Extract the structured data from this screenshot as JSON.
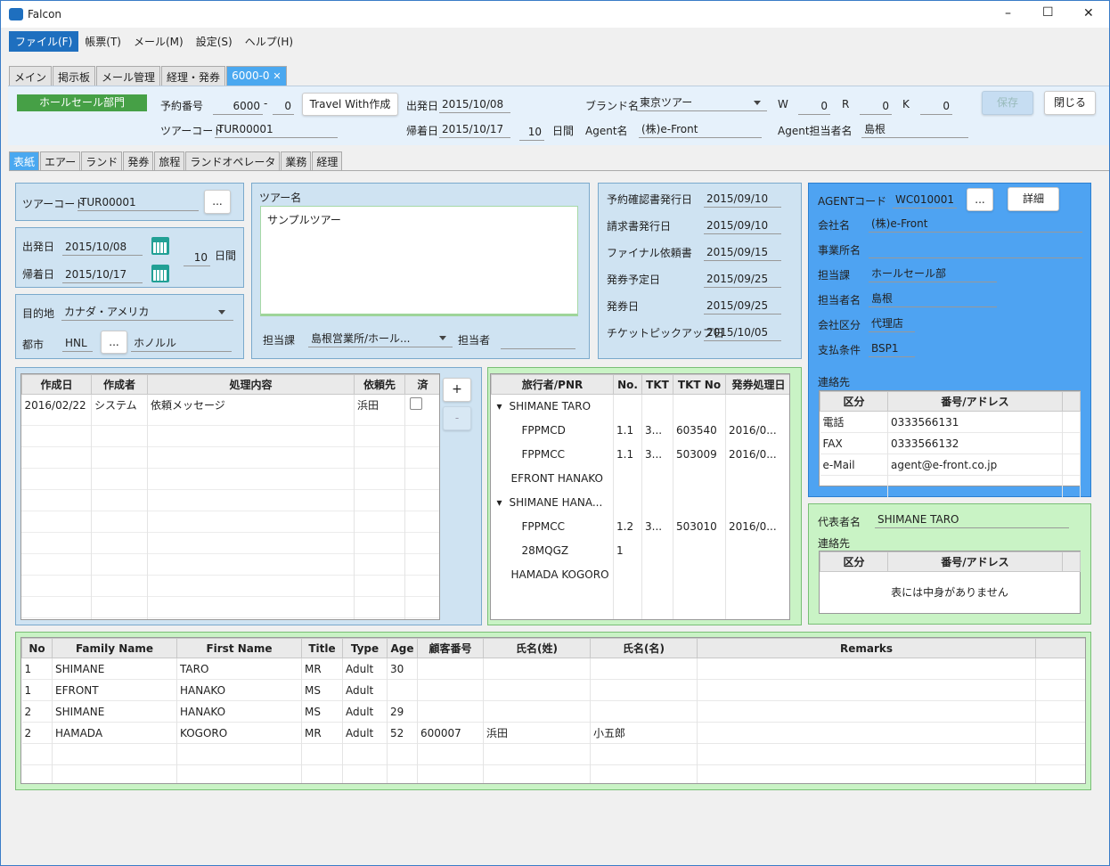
{
  "window": {
    "title": "Falcon",
    "min": "–",
    "max": "☐",
    "close": "✕"
  },
  "menubar": [
    "ファイル(F)",
    "帳票(T)",
    "メール(M)",
    "設定(S)",
    "ヘルプ(H)"
  ],
  "tabs": [
    "メイン",
    "掲示板",
    "メール管理",
    "経理・発券",
    "6000-0"
  ],
  "tab_close": "✕",
  "header": {
    "dept": "ホールセール部門",
    "booking_label": "予約番号",
    "booking_no": "6000",
    "booking_sep": "-",
    "booking_sub": "0",
    "travel_btn": "Travel With作成",
    "depart_label": "出発日",
    "depart": "2015/10/08",
    "brand_label": "ブランド名",
    "brand": "東京ツアー",
    "w_label": "W",
    "w": "0",
    "r_label": "R",
    "r": "0",
    "k_label": "K",
    "k": "0",
    "save": "保存",
    "close": "閉じる",
    "tour_label": "ツアーコード",
    "tour": "TUR00001",
    "return_label": "帰着日",
    "return": "2015/10/17",
    "days": "10",
    "days_label": "日間",
    "agent_label": "Agent名",
    "agent": "(株)e-Front",
    "agent_person_label": "Agent担当者名",
    "agent_person": "島根"
  },
  "subtabs": [
    "表紙",
    "エアー",
    "ランド",
    "発券",
    "旅程",
    "ランドオペレータ",
    "業務",
    "経理"
  ],
  "left": {
    "tour_label": "ツアーコード",
    "tour": "TUR00001",
    "dots": "...",
    "depart_label": "出発日",
    "depart": "2015/10/08",
    "return_label": "帰着日",
    "return": "2015/10/17",
    "days": "10",
    "days_label": "日間",
    "dest_label": "目的地",
    "dest": "カナダ・アメリカ",
    "city_label": "都市",
    "city_code": "HNL",
    "city_name": "ホノルル"
  },
  "tourname": {
    "label": "ツアー名",
    "value": "サンプルツアー",
    "dept_label": "担当課",
    "dept": "島根営業所/ホール...",
    "person_label": "担当者"
  },
  "dates": [
    {
      "label": "予約確認書発行日",
      "value": "2015/09/10"
    },
    {
      "label": "請求書発行日",
      "value": "2015/09/10"
    },
    {
      "label": "ファイナル依頼書",
      "value": "2015/09/15"
    },
    {
      "label": "発券予定日",
      "value": "2015/09/25"
    },
    {
      "label": "発券日",
      "value": "2015/09/25"
    },
    {
      "label": "チケットピックアップ日",
      "value": "2015/10/05"
    }
  ],
  "agent": {
    "code_label": "AGENTコード",
    "code": "WC010001",
    "dots": "...",
    "detail": "詳細",
    "company_label": "会社名",
    "company": "(株)e-Front",
    "office_label": "事業所名",
    "office": "",
    "section_label": "担当課",
    "section": "ホールセール部",
    "person_label": "担当者名",
    "person": "島根",
    "class_label": "会社区分",
    "class": "代理店",
    "pay_label": "支払条件",
    "pay": "BSP1",
    "contact_label": "連絡先",
    "contact_headers": [
      "区分",
      "番号/アドレス"
    ],
    "contacts": [
      [
        "電話",
        "0333566131"
      ],
      [
        "FAX",
        "0333566132"
      ],
      [
        "e-Mail",
        "agent@e-front.co.jp"
      ]
    ]
  },
  "rep": {
    "label": "代表者名",
    "name": "SHIMANE TARO",
    "contact_label": "連絡先",
    "headers": [
      "区分",
      "番号/アドレス"
    ],
    "empty": "表には中身がありません"
  },
  "history": {
    "headers": [
      "作成日",
      "作成者",
      "処理内容",
      "依頼先",
      "済"
    ],
    "rows": [
      [
        "2016/02/22",
        "システム",
        "依頼メッセージ",
        "浜田"
      ]
    ],
    "add": "+",
    "remove": "-"
  },
  "pnr": {
    "headers": [
      "旅行者/PNR",
      "No.",
      "TKT",
      "TKT No",
      "発券処理日"
    ],
    "rows": [
      {
        "name": "SHIMANE TARO",
        "lvl": 0,
        "exp": true,
        "no": "",
        "tkt": "",
        "tktno": "",
        "date": ""
      },
      {
        "name": "FPPMCD",
        "lvl": 1,
        "exp": false,
        "no": "1.1",
        "tkt": "3...",
        "tktno": "603540",
        "date": "2016/0..."
      },
      {
        "name": "FPPMCC",
        "lvl": 1,
        "exp": false,
        "no": "1.1",
        "tkt": "3...",
        "tktno": "503009",
        "date": "2016/0..."
      },
      {
        "name": "EFRONT HANAKO",
        "lvl": 0,
        "exp": false,
        "no": "",
        "tkt": "",
        "tktno": "",
        "date": ""
      },
      {
        "name": "SHIMANE HANA...",
        "lvl": 0,
        "exp": true,
        "no": "",
        "tkt": "",
        "tktno": "",
        "date": ""
      },
      {
        "name": "FPPMCC",
        "lvl": 1,
        "exp": false,
        "no": "1.2",
        "tkt": "3...",
        "tktno": "503010",
        "date": "2016/0..."
      },
      {
        "name": "28MQGZ",
        "lvl": 1,
        "exp": false,
        "no": "1",
        "tkt": "",
        "tktno": "",
        "date": ""
      },
      {
        "name": "HAMADA KOGORO",
        "lvl": 0,
        "exp": false,
        "no": "",
        "tkt": "",
        "tktno": "",
        "date": ""
      }
    ]
  },
  "pax": {
    "headers": [
      "No",
      "Family Name",
      "First Name",
      "Title",
      "Type",
      "Age",
      "顧客番号",
      "氏名(姓)",
      "氏名(名)",
      "Remarks"
    ],
    "rows": [
      [
        "1",
        "SHIMANE",
        "TARO",
        "MR",
        "Adult",
        "30",
        "",
        "",
        "",
        ""
      ],
      [
        "1",
        "EFRONT",
        "HANAKO",
        "MS",
        "Adult",
        "",
        "",
        "",
        "",
        ""
      ],
      [
        "2",
        "SHIMANE",
        "HANAKO",
        "MS",
        "Adult",
        "29",
        "",
        "",
        "",
        ""
      ],
      [
        "2",
        "HAMADA",
        "KOGORO",
        "MR",
        "Adult",
        "52",
        "600007",
        "浜田",
        "小五郎",
        ""
      ]
    ]
  }
}
